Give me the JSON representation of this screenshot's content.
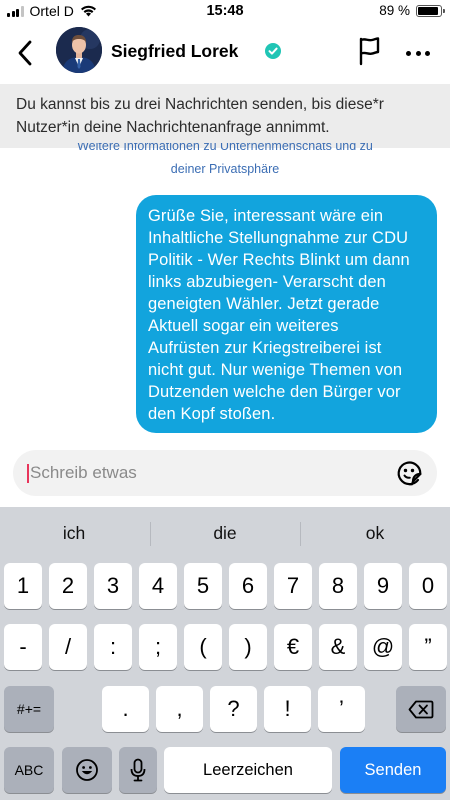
{
  "status_bar": {
    "carrier": "Ortel D",
    "time": "15:48",
    "battery_text": "89 %",
    "battery_level": 0.89
  },
  "header": {
    "contact_name": "Siegfried Lorek"
  },
  "notice": {
    "text": "Du kannst bis zu drei Nachrichten senden, bis diese*r Nutzer*in deine Nachrichtenanfrage annimmt."
  },
  "chat": {
    "privacy_link_line1": "Weitere Informationen zu Unternehmenschats und zu",
    "privacy_link_line2": "deiner Privatsphäre",
    "message_text": "Grüße Sie, interessant wäre ein\nInhaltliche Stellungnahme zur CDU\nPolitik - Wer Rechts Blinkt um dann\nlinks abzubiegen- Verarscht den\ngeneigten Wähler. Jetzt gerade\nAktuell sogar ein weiteres\nAufrüsten zur Kriegstreiberei ist\nnicht gut. Nur wenige Themen von\nDutzenden welche den Bürger vor\nden Kopf stoßen."
  },
  "composer": {
    "placeholder": "Schreib etwas"
  },
  "keyboard": {
    "suggestions": [
      "ich",
      "die",
      "ok"
    ],
    "row1": [
      "1",
      "2",
      "3",
      "4",
      "5",
      "6",
      "7",
      "8",
      "9",
      "0"
    ],
    "row2": [
      "-",
      "/",
      ":",
      ";",
      "(",
      ")",
      "€",
      "&",
      "@",
      "”"
    ],
    "row3_toggle": "#+=",
    "row3": [
      ".",
      ",",
      "?",
      "!",
      "’"
    ],
    "abc_label": "ABC",
    "space_label": "Leerzeichen",
    "send_label": "Senden"
  },
  "colors": {
    "bubble": "#12a4dd",
    "send_key": "#1b7ff5",
    "verified_badge": "#20c5b5",
    "keyboard_bg": "#d1d4d9"
  },
  "icons": [
    "back-arrow",
    "verified-badge",
    "flag",
    "more-dots",
    "emoji-smiley",
    "backspace",
    "emoji-keyboard",
    "microphone"
  ]
}
